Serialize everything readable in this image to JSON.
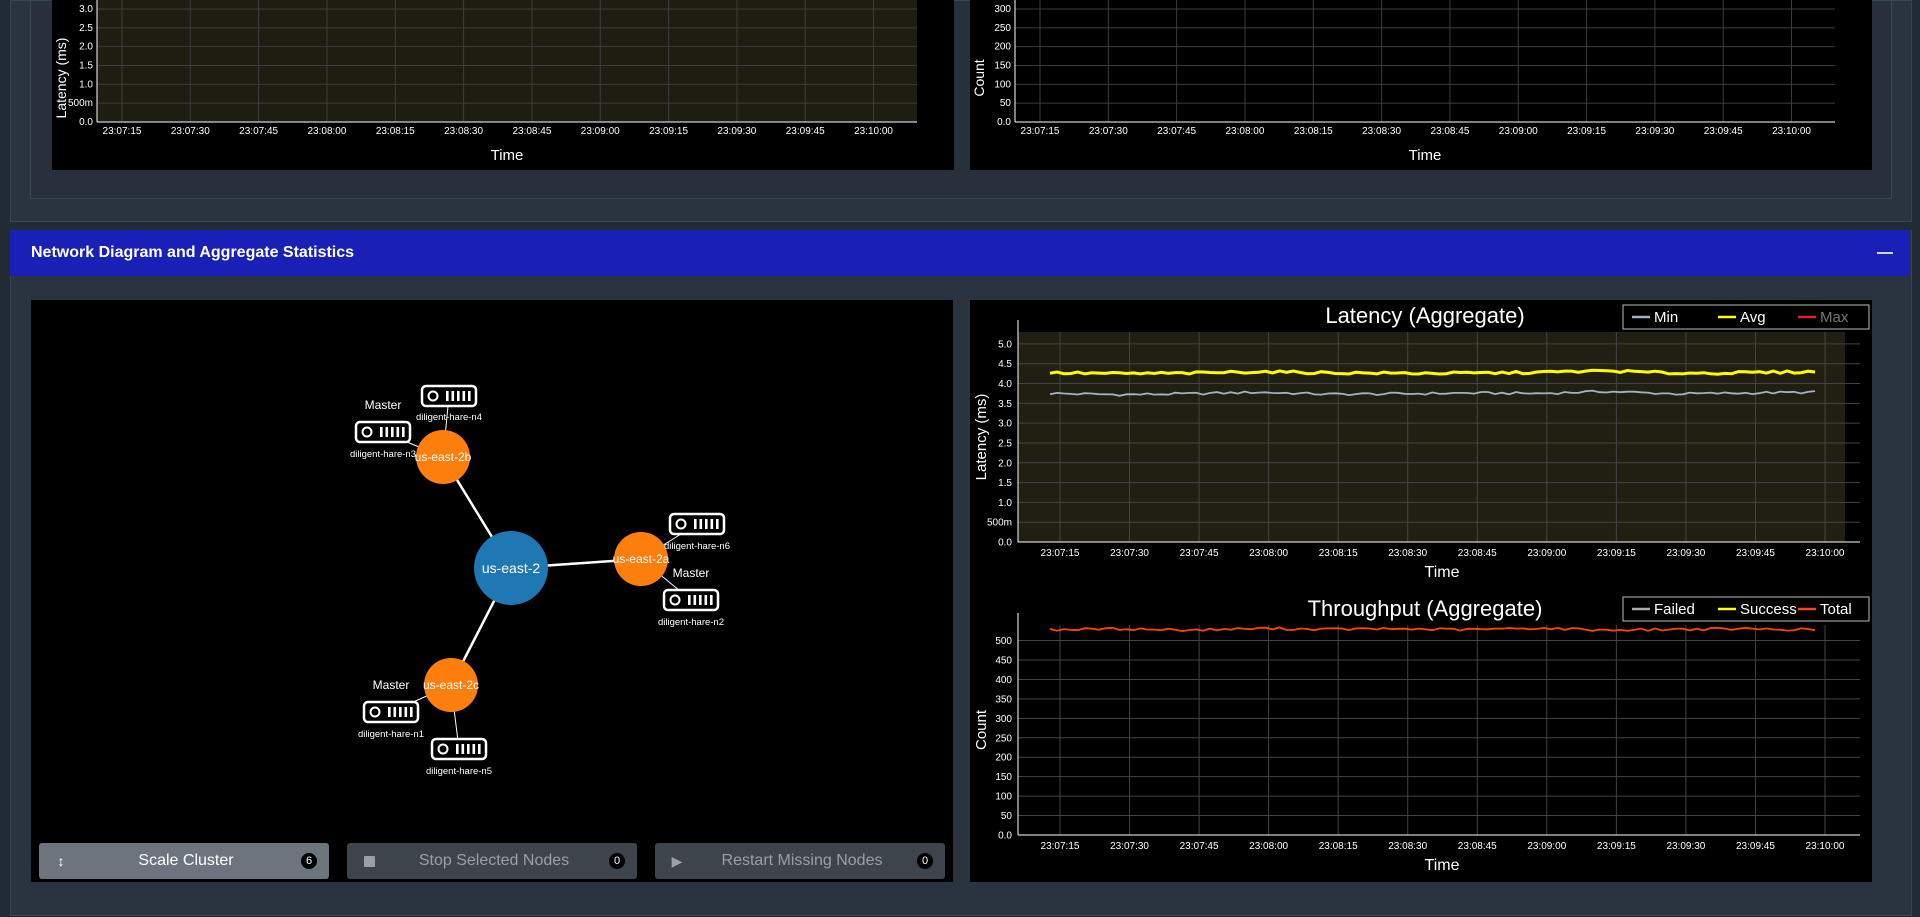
{
  "top_charts": {
    "left": {
      "ylabel": "Latency (ms)",
      "xlabel": "Time",
      "y_ticks": [
        "3.0",
        "2.5",
        "2.0",
        "1.5",
        "1.0",
        "500m",
        "0.0"
      ]
    },
    "right": {
      "ylabel": "Count",
      "xlabel": "Time",
      "y_ticks": [
        "300",
        "250",
        "200",
        "150",
        "100",
        "50",
        "0.0"
      ]
    },
    "x_ticks": [
      "23:07:15",
      "23:07:30",
      "23:07:45",
      "23:08:00",
      "23:08:15",
      "23:08:30",
      "23:08:45",
      "23:09:00",
      "23:09:15",
      "23:09:30",
      "23:09:45",
      "23:10:00"
    ]
  },
  "section": {
    "title": "Network Diagram and Aggregate Statistics",
    "collapse_label": "—"
  },
  "network": {
    "region": "us-east-2",
    "zones": [
      {
        "name": "us-east-2b",
        "nodes": [
          {
            "name": "diligent-hare-n3",
            "role": "Master"
          },
          {
            "name": "diligent-hare-n4",
            "role": ""
          }
        ]
      },
      {
        "name": "us-east-2a",
        "nodes": [
          {
            "name": "diligent-hare-n6",
            "role": ""
          },
          {
            "name": "diligent-hare-n2",
            "role": "Master"
          }
        ]
      },
      {
        "name": "us-east-2c",
        "nodes": [
          {
            "name": "diligent-hare-n1",
            "role": "Master"
          },
          {
            "name": "diligent-hare-n5",
            "role": ""
          }
        ]
      }
    ],
    "colors": {
      "region": "#1f77b4",
      "zone": "#ff7f0e"
    }
  },
  "buttons": {
    "scale": {
      "label": "Scale Cluster",
      "count": "6",
      "icon": "resize-vertical-icon"
    },
    "stop": {
      "label": "Stop Selected Nodes",
      "count": "0",
      "icon": "stop-icon"
    },
    "restart": {
      "label": "Restart Missing Nodes",
      "count": "0",
      "icon": "play-icon"
    }
  },
  "chart_data": [
    {
      "type": "line",
      "title": "Latency (Aggregate)",
      "xlabel": "Time",
      "ylabel": "Latency (ms)",
      "ylim": [
        0,
        5.3
      ],
      "y_ticks": [
        0,
        0.5,
        1.0,
        1.5,
        2.0,
        2.5,
        3.0,
        3.5,
        4.0,
        4.5,
        5.0
      ],
      "y_tick_labels": [
        "0.0",
        "500m",
        "1.0",
        "1.5",
        "2.0",
        "2.5",
        "3.0",
        "3.5",
        "4.0",
        "4.5",
        "5.0"
      ],
      "x": [
        "23:07:15",
        "23:07:30",
        "23:07:45",
        "23:08:00",
        "23:08:15",
        "23:08:30",
        "23:08:45",
        "23:09:00",
        "23:09:15",
        "23:09:30",
        "23:09:45",
        "23:10:00"
      ],
      "legend": "top-right",
      "series": [
        {
          "name": "Min",
          "color": "#9fb3c8",
          "values": [
            3.75,
            3.72,
            3.74,
            3.78,
            3.73,
            3.74,
            3.76,
            3.75,
            3.8,
            3.74,
            3.76,
            3.78
          ]
        },
        {
          "name": "Avg",
          "color": "#ffff00",
          "values": [
            4.27,
            4.25,
            4.26,
            4.3,
            4.27,
            4.26,
            4.26,
            4.28,
            4.32,
            4.26,
            4.27,
            4.3
          ]
        },
        {
          "name": "Max",
          "color": "#d62728",
          "values": []
        }
      ]
    },
    {
      "type": "line",
      "title": "Throughput (Aggregate)",
      "xlabel": "Time",
      "ylabel": "Count",
      "ylim": [
        0,
        540
      ],
      "y_ticks": [
        0,
        50,
        100,
        150,
        200,
        250,
        300,
        350,
        400,
        450,
        500
      ],
      "y_tick_labels": [
        "0.0",
        "50",
        "100",
        "150",
        "200",
        "250",
        "300",
        "350",
        "400",
        "450",
        "500"
      ],
      "x": [
        "23:07:15",
        "23:07:30",
        "23:07:45",
        "23:08:00",
        "23:08:15",
        "23:08:30",
        "23:08:45",
        "23:09:00",
        "23:09:15",
        "23:09:30",
        "23:09:45",
        "23:10:00"
      ],
      "legend": "top-right",
      "series": [
        {
          "name": "Failed",
          "color": "#aaaaaa",
          "values": []
        },
        {
          "name": "Success",
          "color": "#ffff00",
          "values": []
        },
        {
          "name": "Total",
          "color": "#ff4500",
          "values": [
            528,
            530,
            527,
            531,
            529,
            530,
            528,
            532,
            527,
            529,
            530,
            528
          ]
        }
      ]
    }
  ]
}
